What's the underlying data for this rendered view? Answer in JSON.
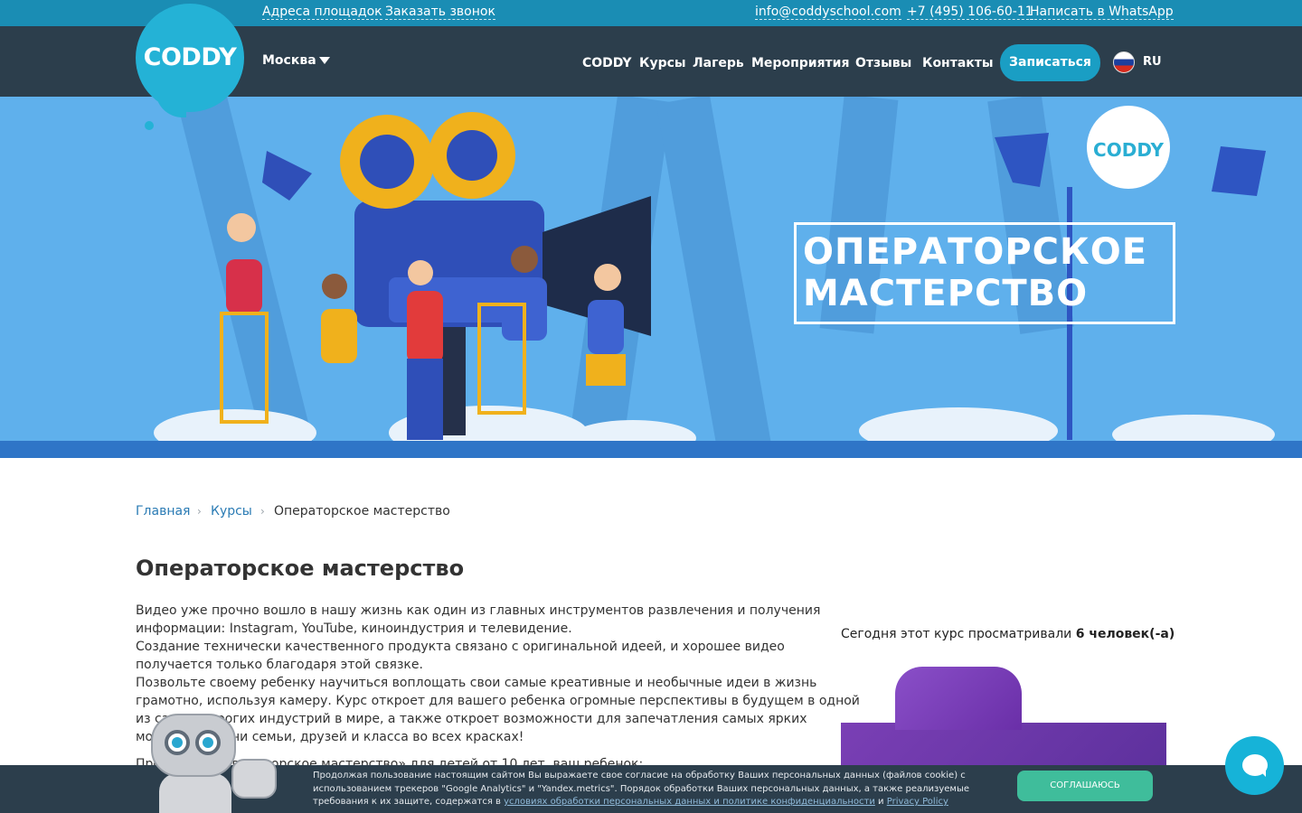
{
  "topbar": {
    "addresses": "Адреса площадок",
    "callback": "Заказать звонок",
    "email": "info@coddyschool.com",
    "phone": "+7 (495) 106-60-11",
    "whatsapp": "Написать в WhatsApp"
  },
  "header": {
    "logo": "CODDY",
    "city": "Москва",
    "menu": [
      "CODDY",
      "Курсы",
      "Лагерь",
      "Мероприятия",
      "Отзывы",
      "Контакты"
    ],
    "signup": "Записаться",
    "language": "RU"
  },
  "hero": {
    "title": "ОПЕРАТОРСКОЕ\nМАСТЕРСТВО",
    "logo": "CODDY"
  },
  "breadcrumb": {
    "home": "Главная",
    "courses": "Курсы",
    "current": "Операторское мастерство",
    "separator": "›"
  },
  "page": {
    "title": "Операторское мастерство",
    "description": [
      "Видео уже прочно вошло в нашу жизнь как один из главных инструментов развлечения и получения",
      "информации: Instagram, YouTube, киноиндустрия и телевидение.",
      "Создание технически качественного продукта связано с оригинальной идеей, и хорошее видео",
      "получается только благодаря этой связке.",
      "Позвольте своему ребенку научиться воплощать свои самые креативные и необычные идеи в жизнь",
      "грамотно, используя камеру. Курс откроет для вашего ребенка огромные перспективы в будущем в одной",
      "из самых дорогих индустрий в мире, а также откроет возможности для запечатления самых ярких",
      "моментов жизни семьи, друзей и класса во всех красках!",
      "Программа «Операторское мастерство» для детей от 10 лет, ваш ребенок:"
    ],
    "viewers_prefix": "Сегодня этот курс просматривали ",
    "viewers_count": "6 человек(-а)"
  },
  "cookie": {
    "text": "Продолжая пользование настоящим сайтом Вы выражаете свое согласие на обработку Ваших персональных данных (файлов cookie) с использованием трекеров \"Google Analytics\" и \"Yandex.metrics\". Порядок обработки Ваших персональных данных, а также реализуемые требования к их защите, содержатся в ",
    "policy_link": "условиях обработки персональных данных и политике конфиденциальности",
    "and": " и ",
    "privacy_link": "Privacy Policy",
    "accept": "СОГЛАШАЮСЬ"
  },
  "colors": {
    "topbar": "#1a8db4",
    "navbar": "#2c3e4c",
    "accent": "#24b2d6",
    "hero": "#5fb0ec",
    "cookie_button": "#3fbd9b"
  },
  "icons": {
    "city_dropdown": "caret-down-icon",
    "language": "russia-flag-icon",
    "chat": "chat-icon",
    "breadcrumb_separator": "chevron-right-icon"
  }
}
